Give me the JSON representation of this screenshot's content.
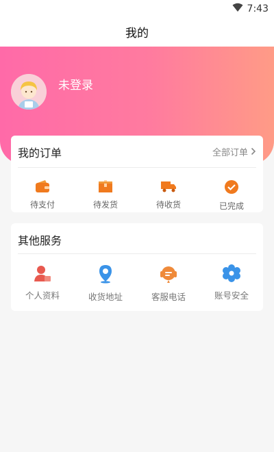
{
  "status": {
    "time": "7:43"
  },
  "header": {
    "title": "我的"
  },
  "profile": {
    "login_text": "未登录"
  },
  "orders": {
    "title": "我的订单",
    "view_all": "全部订单",
    "items": [
      {
        "label": "待支付",
        "icon": "wallet-icon"
      },
      {
        "label": "待发货",
        "icon": "package-icon"
      },
      {
        "label": "待收货",
        "icon": "truck-icon"
      },
      {
        "label": "已完成",
        "icon": "check-circle-icon"
      }
    ]
  },
  "services": {
    "title": "其他服务",
    "items": [
      {
        "label": "个人资料",
        "icon": "person-icon"
      },
      {
        "label": "收货地址",
        "icon": "location-pin-icon"
      },
      {
        "label": "客服电话",
        "icon": "headset-icon"
      },
      {
        "label": "账号安全",
        "icon": "gear-icon"
      }
    ]
  },
  "colors": {
    "hero_gradient_start": "#ff6aa8",
    "hero_gradient_end": "#ff9b86",
    "order_icon_orange": "#f07a1e",
    "service_icon_red": "#e8594f",
    "service_icon_blue": "#3a93e8",
    "service_icon_orange": "#ef8a3a"
  }
}
